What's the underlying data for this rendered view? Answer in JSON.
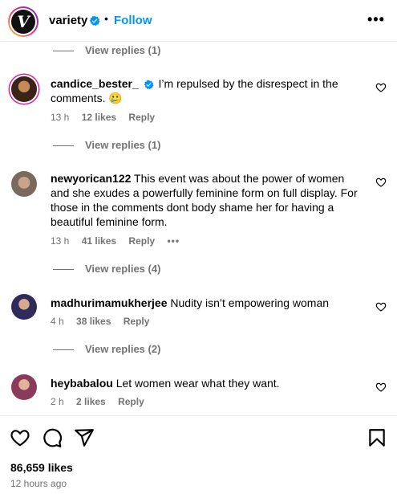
{
  "header": {
    "logo_letter": "V",
    "username": "variety",
    "separator": "•",
    "follow_label": "Follow",
    "more_label": "•••"
  },
  "replies": [
    {
      "label": "View replies (1)"
    },
    {
      "label": "View replies (1)"
    },
    {
      "label": "View replies (4)"
    },
    {
      "label": "View replies (2)"
    }
  ],
  "comments": [
    {
      "username": "candice_bester_",
      "verified": true,
      "text": "I’m repulsed by the disrespect in the comments. 🥲",
      "time": "13 h",
      "likes": "12 likes",
      "reply": "Reply"
    },
    {
      "username": "newyorican122",
      "verified": false,
      "text": "This event was about the power of women and she exudes a powerfully feminine form on full display. For those in the comments dont body shame her for having a beautiful feminine form.",
      "time": "13 h",
      "likes": "41 likes",
      "reply": "Reply",
      "more": "•••"
    },
    {
      "username": "madhurimamukherjee",
      "verified": false,
      "text": "Nudity isn’t empowering woman",
      "time": "4 h",
      "likes": "38 likes",
      "reply": "Reply"
    },
    {
      "username": "heybabalou",
      "verified": false,
      "text": "Let women wear what they want.",
      "time": "2 h",
      "likes": "2 likes",
      "reply": "Reply"
    }
  ],
  "footer": {
    "likes": "86,659 likes",
    "time": "12 hours ago"
  },
  "colors": {
    "accent": "#0095f6",
    "muted": "#737373",
    "verified": "#0095f6"
  },
  "icons": [
    "heart-icon",
    "comment-icon",
    "share-icon",
    "bookmark-icon",
    "verified-badge-icon",
    "more-options-icon"
  ]
}
